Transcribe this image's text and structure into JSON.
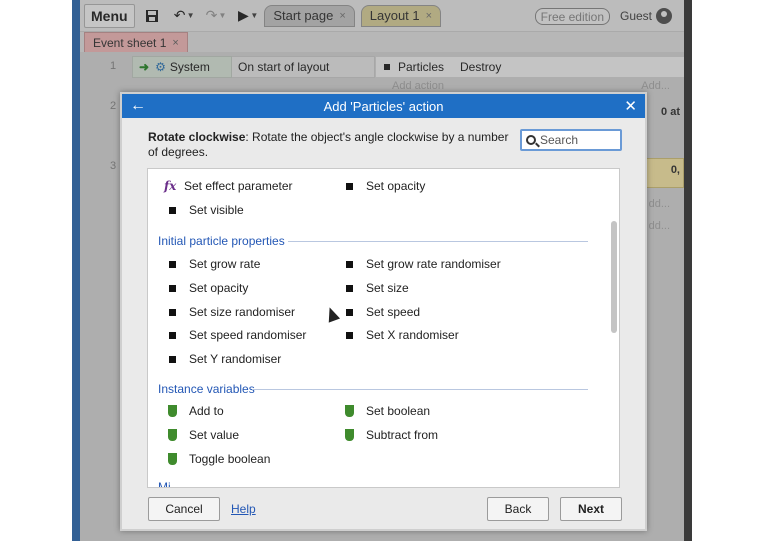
{
  "toolbar": {
    "menu_label": "Menu",
    "tabs": [
      {
        "label": "Start page",
        "close": "×"
      },
      {
        "label": "Layout 1",
        "close": "×"
      }
    ],
    "edition_badge": "Free edition",
    "user": "Guest"
  },
  "sheet_tab": {
    "label": "Event sheet 1",
    "close": "×"
  },
  "events": {
    "row_numbers": [
      "1",
      "2",
      "3"
    ],
    "row1": {
      "object": "System",
      "condition": "On start of layout",
      "action_object": "Particles",
      "action": "Destroy",
      "add_action": "Add action",
      "add_right": "Add..."
    },
    "fragments": {
      "row2": "0 at",
      "row3": "0,",
      "add1": "dd...",
      "add2": "dd..."
    }
  },
  "modal": {
    "title": "Add 'Particles' action",
    "back_glyph": "←",
    "close_glyph": "✕",
    "description_bold": "Rotate clockwise",
    "description_rest": ": Rotate the object's angle clockwise by a number of degrees.",
    "search": {
      "placeholder": "Search",
      "value": ""
    },
    "top_items": [
      {
        "icon": "fx",
        "label": "Set effect parameter"
      },
      {
        "icon": "square",
        "label": "Set opacity"
      },
      {
        "icon": "square",
        "label": "Set visible"
      }
    ],
    "sections": [
      {
        "title": "Initial particle properties",
        "items": [
          {
            "icon": "square",
            "label": "Set grow rate"
          },
          {
            "icon": "square",
            "label": "Set grow rate randomiser"
          },
          {
            "icon": "square",
            "label": "Set opacity"
          },
          {
            "icon": "square",
            "label": "Set size"
          },
          {
            "icon": "square",
            "label": "Set size randomiser"
          },
          {
            "icon": "square",
            "label": "Set speed"
          },
          {
            "icon": "square",
            "label": "Set speed randomiser"
          },
          {
            "icon": "square",
            "label": "Set X randomiser"
          },
          {
            "icon": "square",
            "label": "Set Y randomiser"
          }
        ]
      },
      {
        "title": "Instance variables",
        "items": [
          {
            "icon": "shield",
            "label": "Add to"
          },
          {
            "icon": "shield",
            "label": "Set boolean"
          },
          {
            "icon": "shield",
            "label": "Set value"
          },
          {
            "icon": "shield",
            "label": "Subtract from"
          },
          {
            "icon": "shield",
            "label": "Toggle boolean"
          }
        ]
      }
    ],
    "next_section_partial": "Mi",
    "buttons": {
      "cancel": "Cancel",
      "help": "Help",
      "back": "Back",
      "next": "Next"
    }
  },
  "colors": {
    "header_blue": "#1f6fc5",
    "section_blue": "#2357b5",
    "shield_green": "#3f8b2d",
    "fx_purple": "#6b2f8a",
    "sheet_tab_pink": "#f0b9b9",
    "layout_tab_yellow": "#d8cf9a"
  }
}
